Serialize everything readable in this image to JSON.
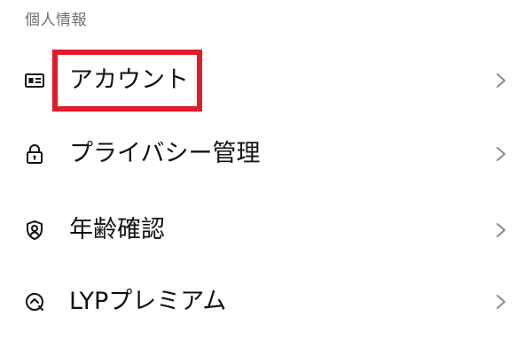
{
  "section": {
    "title": "個人情報"
  },
  "items": [
    {
      "label": "アカウント",
      "icon": "id-card-icon"
    },
    {
      "label": "プライバシー管理",
      "icon": "lock-icon"
    },
    {
      "label": "年齢確認",
      "icon": "shield-person-icon"
    },
    {
      "label": "LYPプレミアム",
      "icon": "premium-badge-icon"
    }
  ],
  "colors": {
    "highlight": "#e21a2c",
    "header_text": "#6f6f6f",
    "chevron": "#8a8a8a"
  }
}
